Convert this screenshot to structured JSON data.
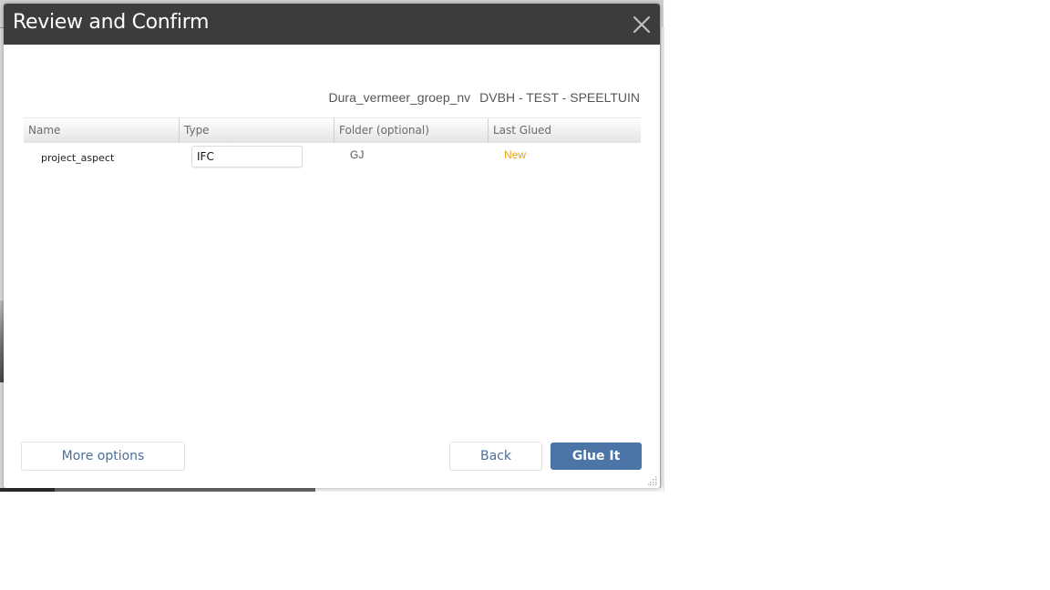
{
  "dialog": {
    "title": "Review and Confirm",
    "close_icon": "close-icon",
    "context": {
      "organization": "Dura_vermeer_groep_nv",
      "project": "DVBH - TEST - SPEELTUIN"
    }
  },
  "table": {
    "columns": [
      "Name",
      "Type",
      "Folder (optional)",
      "Last Glued"
    ],
    "rows": [
      {
        "name": "project_aspect",
        "type": "IFC",
        "folder": "GJ",
        "last_glued": "New"
      }
    ]
  },
  "footer": {
    "more_options_label": "More options",
    "back_label": "Back",
    "glue_label": "Glue It"
  },
  "colors": {
    "header_bg": "#3c3c3c",
    "primary": "#4a75a6",
    "status_new": "#e8a21a",
    "link_text": "#4a6f9a"
  },
  "icons": {
    "close": "close-icon",
    "resize": "resize-grip-icon"
  }
}
